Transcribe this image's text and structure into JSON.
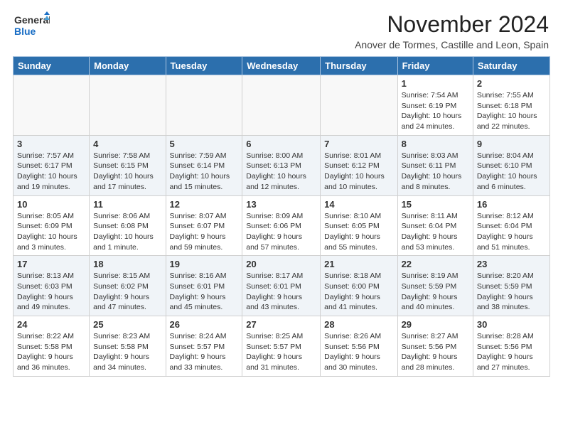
{
  "header": {
    "logo_line1": "General",
    "logo_line2": "Blue",
    "month_title": "November 2024",
    "subtitle": "Anover de Tormes, Castille and Leon, Spain"
  },
  "days_of_week": [
    "Sunday",
    "Monday",
    "Tuesday",
    "Wednesday",
    "Thursday",
    "Friday",
    "Saturday"
  ],
  "weeks": [
    [
      {
        "day": "",
        "info": ""
      },
      {
        "day": "",
        "info": ""
      },
      {
        "day": "",
        "info": ""
      },
      {
        "day": "",
        "info": ""
      },
      {
        "day": "",
        "info": ""
      },
      {
        "day": "1",
        "info": "Sunrise: 7:54 AM\nSunset: 6:19 PM\nDaylight: 10 hours and 24 minutes."
      },
      {
        "day": "2",
        "info": "Sunrise: 7:55 AM\nSunset: 6:18 PM\nDaylight: 10 hours and 22 minutes."
      }
    ],
    [
      {
        "day": "3",
        "info": "Sunrise: 7:57 AM\nSunset: 6:17 PM\nDaylight: 10 hours and 19 minutes."
      },
      {
        "day": "4",
        "info": "Sunrise: 7:58 AM\nSunset: 6:15 PM\nDaylight: 10 hours and 17 minutes."
      },
      {
        "day": "5",
        "info": "Sunrise: 7:59 AM\nSunset: 6:14 PM\nDaylight: 10 hours and 15 minutes."
      },
      {
        "day": "6",
        "info": "Sunrise: 8:00 AM\nSunset: 6:13 PM\nDaylight: 10 hours and 12 minutes."
      },
      {
        "day": "7",
        "info": "Sunrise: 8:01 AM\nSunset: 6:12 PM\nDaylight: 10 hours and 10 minutes."
      },
      {
        "day": "8",
        "info": "Sunrise: 8:03 AM\nSunset: 6:11 PM\nDaylight: 10 hours and 8 minutes."
      },
      {
        "day": "9",
        "info": "Sunrise: 8:04 AM\nSunset: 6:10 PM\nDaylight: 10 hours and 6 minutes."
      }
    ],
    [
      {
        "day": "10",
        "info": "Sunrise: 8:05 AM\nSunset: 6:09 PM\nDaylight: 10 hours and 3 minutes."
      },
      {
        "day": "11",
        "info": "Sunrise: 8:06 AM\nSunset: 6:08 PM\nDaylight: 10 hours and 1 minute."
      },
      {
        "day": "12",
        "info": "Sunrise: 8:07 AM\nSunset: 6:07 PM\nDaylight: 9 hours and 59 minutes."
      },
      {
        "day": "13",
        "info": "Sunrise: 8:09 AM\nSunset: 6:06 PM\nDaylight: 9 hours and 57 minutes."
      },
      {
        "day": "14",
        "info": "Sunrise: 8:10 AM\nSunset: 6:05 PM\nDaylight: 9 hours and 55 minutes."
      },
      {
        "day": "15",
        "info": "Sunrise: 8:11 AM\nSunset: 6:04 PM\nDaylight: 9 hours and 53 minutes."
      },
      {
        "day": "16",
        "info": "Sunrise: 8:12 AM\nSunset: 6:04 PM\nDaylight: 9 hours and 51 minutes."
      }
    ],
    [
      {
        "day": "17",
        "info": "Sunrise: 8:13 AM\nSunset: 6:03 PM\nDaylight: 9 hours and 49 minutes."
      },
      {
        "day": "18",
        "info": "Sunrise: 8:15 AM\nSunset: 6:02 PM\nDaylight: 9 hours and 47 minutes."
      },
      {
        "day": "19",
        "info": "Sunrise: 8:16 AM\nSunset: 6:01 PM\nDaylight: 9 hours and 45 minutes."
      },
      {
        "day": "20",
        "info": "Sunrise: 8:17 AM\nSunset: 6:01 PM\nDaylight: 9 hours and 43 minutes."
      },
      {
        "day": "21",
        "info": "Sunrise: 8:18 AM\nSunset: 6:00 PM\nDaylight: 9 hours and 41 minutes."
      },
      {
        "day": "22",
        "info": "Sunrise: 8:19 AM\nSunset: 5:59 PM\nDaylight: 9 hours and 40 minutes."
      },
      {
        "day": "23",
        "info": "Sunrise: 8:20 AM\nSunset: 5:59 PM\nDaylight: 9 hours and 38 minutes."
      }
    ],
    [
      {
        "day": "24",
        "info": "Sunrise: 8:22 AM\nSunset: 5:58 PM\nDaylight: 9 hours and 36 minutes."
      },
      {
        "day": "25",
        "info": "Sunrise: 8:23 AM\nSunset: 5:58 PM\nDaylight: 9 hours and 34 minutes."
      },
      {
        "day": "26",
        "info": "Sunrise: 8:24 AM\nSunset: 5:57 PM\nDaylight: 9 hours and 33 minutes."
      },
      {
        "day": "27",
        "info": "Sunrise: 8:25 AM\nSunset: 5:57 PM\nDaylight: 9 hours and 31 minutes."
      },
      {
        "day": "28",
        "info": "Sunrise: 8:26 AM\nSunset: 5:56 PM\nDaylight: 9 hours and 30 minutes."
      },
      {
        "day": "29",
        "info": "Sunrise: 8:27 AM\nSunset: 5:56 PM\nDaylight: 9 hours and 28 minutes."
      },
      {
        "day": "30",
        "info": "Sunrise: 8:28 AM\nSunset: 5:56 PM\nDaylight: 9 hours and 27 minutes."
      }
    ]
  ]
}
